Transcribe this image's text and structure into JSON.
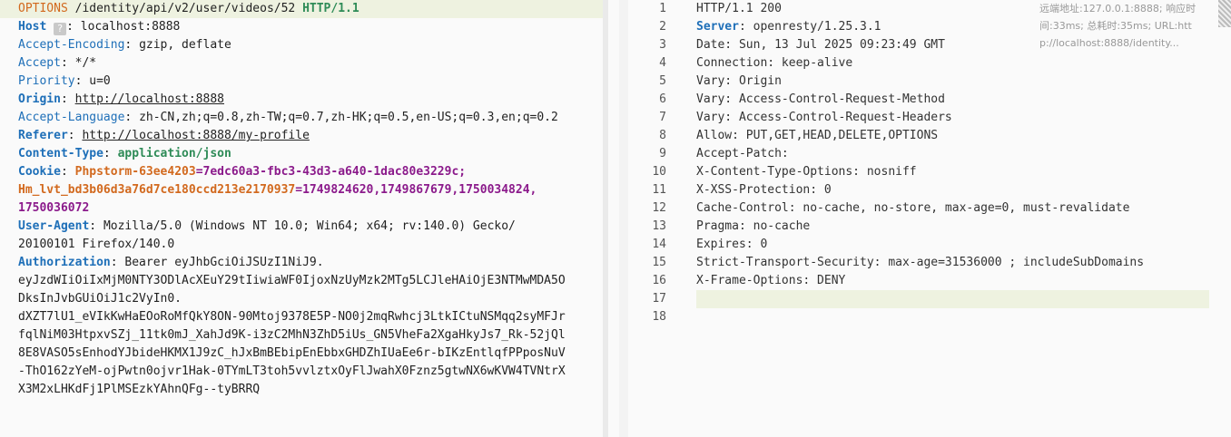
{
  "request": {
    "method": "OPTIONS",
    "path": " /identity/api/v2/user/videos/52 ",
    "version": "HTTP/1.1",
    "lines": [
      {
        "key": "Host",
        "sep": ": ",
        "value": "localhost:8888",
        "badge": "?"
      },
      {
        "key": "Accept-Encoding",
        "sep": ": ",
        "value": "gzip, deflate"
      },
      {
        "key": "Accept",
        "sep": ": ",
        "value": "*/*"
      },
      {
        "key": "Priority",
        "sep": ": ",
        "value": "u=0"
      },
      {
        "key": "Origin",
        "sep": ": ",
        "value": "http://localhost:8888"
      },
      {
        "key": "Accept-Language",
        "sep": ": ",
        "value": "zh-CN,zh;q=0.8,zh-TW;q=0.7,zh-HK;q=0.5,en-US;q=0.3,en;q=0.2"
      },
      {
        "key": "Referer",
        "sep": ": ",
        "value": "http://localhost:8888/my-profile"
      },
      {
        "key": "Content-Type",
        "sep": ": ",
        "value": "application/json"
      }
    ],
    "cookie": {
      "key": "Cookie",
      "c1_name": "Phpstorm-63ee4203",
      "c1_value": "=7edc60a3-fbc3-43d3-a640-1dac80e3229c;",
      "c2_name": "Hm_lvt_bd3b06d3a76d7ce180ccd213e2170937",
      "c2_value": "=1749824620,1749867679,1750034824,",
      "c2_value_cont": "1750036072"
    },
    "user_agent": {
      "key": "User-Agent",
      "value_line1": "Mozilla/5.0 (Windows NT 10.0; Win64; x64; rv:140.0) Gecko/",
      "value_line2": "20100101 Firefox/140.0"
    },
    "authorization": {
      "key": "Authorization",
      "value_line1": "Bearer eyJhbGciOiJSUzI1NiJ9.",
      "token_lines": [
        "eyJzdWIiOiIxMjM0NTY3ODlAcXEuY29tIiwiaWF0IjoxNzUyMzk2MTg5LCJleHAiOjE3NTMwMDA5O",
        "DksInJvbGUiOiJ1c2VyIn0.",
        "dXZT7lU1_eVIkKwHaEOoRoMfQkY8ON-90Mtoj9378E5P-NO0j2mqRwhcj3LtkICtuNSMqq2syMFJr",
        "fqlNiM03HtpxvSZj_11tk0mJ_XahJd9K-i3zC2MhN3ZhD5iUs_GN5VheFa2XgaHkyJs7_Rk-52jQl",
        "8E8VASO5sEnhodYJbideHKMX1J9zC_hJxBmBEbipEnEbbxGHDZhIUaEe6r-bIKzEntlqfPPposNuV",
        "-ThO162zYeM-ojPwtn0ojvr1Hak-0TYmLT3toh5vvlztxOyFlJwahX0Fznz5gtwNX6wKVW4TVNtrX",
        "X3M2xLHKdFj1PlMSEzkYAhnQFg--tyBRRQ"
      ]
    }
  },
  "response": {
    "line_numbers": [
      "1",
      "2",
      "3",
      "4",
      "5",
      "6",
      "7",
      "8",
      "9",
      "10",
      "11",
      "12",
      "13",
      "14",
      "15",
      "16",
      "17",
      "18"
    ],
    "status_line": "HTTP/1.1 200",
    "server_key": "Server",
    "server_value": ": openresty/1.25.3.1",
    "lines": [
      "Date: Sun, 13 Jul 2025 09:23:49 GMT",
      "Connection: keep-alive",
      "Vary: Origin",
      "Vary: Access-Control-Request-Method",
      "Vary: Access-Control-Request-Headers",
      "Allow: PUT,GET,HEAD,DELETE,OPTIONS",
      "Accept-Patch:",
      "X-Content-Type-Options: nosniff",
      "X-XSS-Protection: 0",
      "Cache-Control: no-cache, no-store, max-age=0, must-revalidate",
      "Pragma: no-cache",
      "Expires: 0",
      "Strict-Transport-Security: max-age=31536000 ; includeSubDomains",
      "X-Frame-Options: DENY"
    ]
  },
  "meta": {
    "line1": "远端地址:127.0.0.1:8888; 响应时",
    "line2": "间:33ms; 总耗时:35ms; URL:htt",
    "line3": "p://localhost:8888/identity..."
  }
}
